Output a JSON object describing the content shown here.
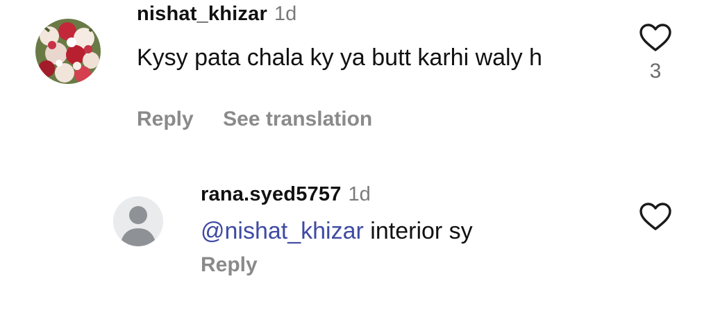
{
  "comments": [
    {
      "username": "nishat_khizar",
      "time": "1d",
      "text": "Kysy pata chala ky ya butt karhi waly h",
      "actions": {
        "reply": "Reply",
        "translate": "See translation"
      },
      "like_count": "3",
      "like_icon": "heart-outline-icon",
      "avatar_icon": "flower-photo-avatar"
    },
    {
      "username": "rana.syed5757",
      "time": "1d",
      "mention": "@nishat_khizar",
      "text": " interior sy",
      "actions": {
        "reply": "Reply"
      },
      "like_icon": "heart-outline-icon",
      "avatar_icon": "default-user-avatar"
    }
  ],
  "colors": {
    "mention": "#3e4aa3",
    "muted": "#8a8a8a",
    "text": "#111111"
  }
}
